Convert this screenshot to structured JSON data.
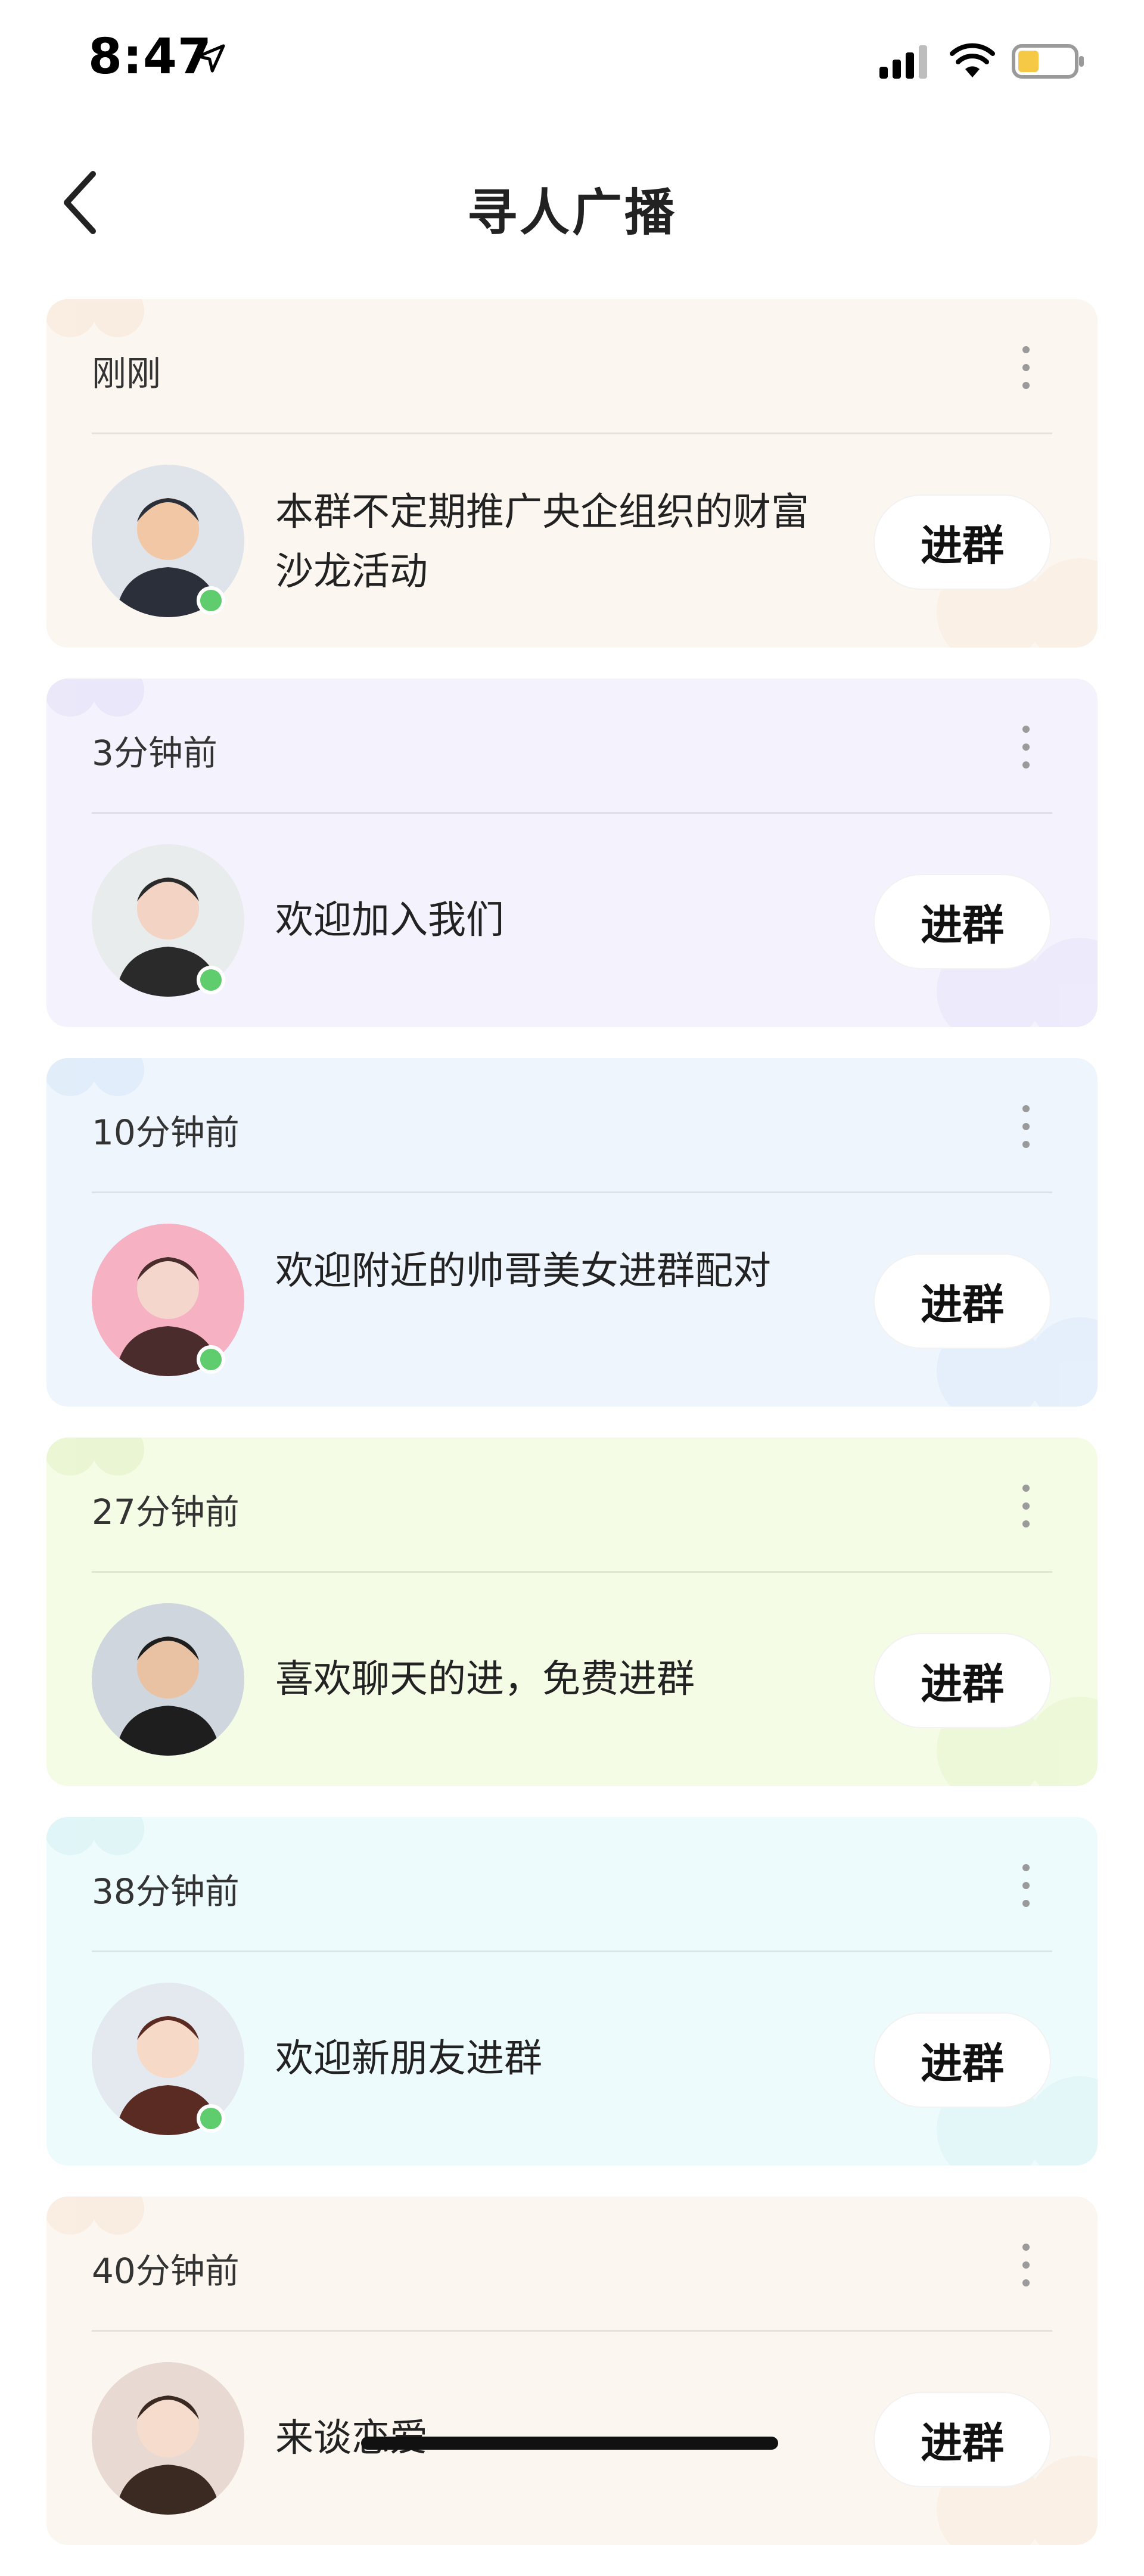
{
  "status_bar": {
    "time": "8:47",
    "icons": [
      "location-arrow-icon",
      "cellular-signal-icon",
      "wifi-icon",
      "battery-icon"
    ],
    "battery_color": "#f5c945"
  },
  "nav": {
    "back_icon": "chevron-left-icon",
    "title": "寻人广播"
  },
  "feed": [
    {
      "time": "刚刚",
      "message": "本群不定期推广央企组织的财富沙龙活动",
      "button": "进群",
      "online": true,
      "bg": "#fcf6f0",
      "accent": "#f8e6d4"
    },
    {
      "time": "3分钟前",
      "message": "欢迎加入我们",
      "button": "进群",
      "online": true,
      "bg": "#f4f3fd",
      "accent": "#e2ddf8"
    },
    {
      "time": "10分钟前",
      "message": "欢迎附近的帅哥美女进群配对",
      "button": "进群",
      "online": true,
      "bg": "#eef5fd",
      "accent": "#d6e6f8"
    },
    {
      "time": "27分钟前",
      "message": "喜欢聊天的进，免费进群",
      "button": "进群",
      "online": false,
      "bg": "#f4fce6",
      "accent": "#e2f2c2"
    },
    {
      "time": "38分钟前",
      "message": "欢迎新朋友进群",
      "button": "进群",
      "online": true,
      "bg": "#edfbfc",
      "accent": "#d2f0f2"
    },
    {
      "time": "40分钟前",
      "message": "来谈恋爱",
      "button": "进群",
      "online": false,
      "bg": "#fcf6f0",
      "accent": "#f8e6d4"
    }
  ]
}
